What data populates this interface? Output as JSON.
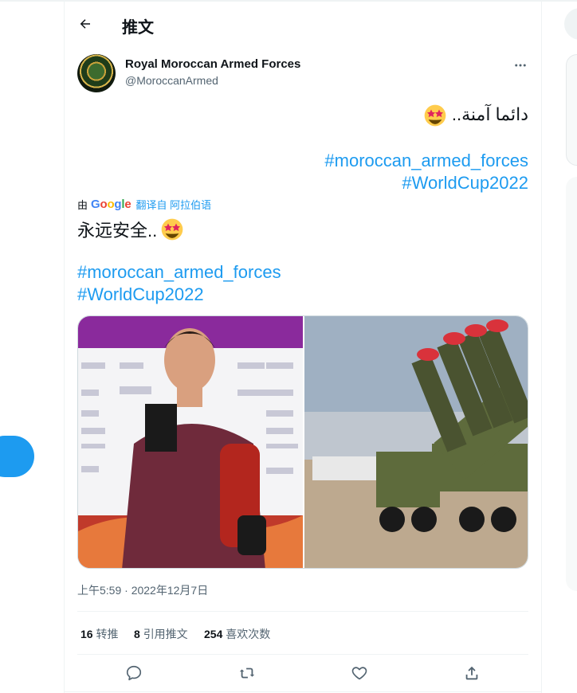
{
  "header": {
    "title": "推文"
  },
  "tweet": {
    "author": {
      "name": "Royal Moroccan Armed Forces",
      "handle": "@MoroccanArmed"
    },
    "text_ar": "دائما آمنة..",
    "hashtags_ar": [
      "#moroccan_armed_forces",
      "#WorldCup2022"
    ],
    "translation": {
      "by_label": "由",
      "google_label": "Google",
      "link_label": "翻译自 阿拉伯语",
      "text": "永远安全..",
      "hashtags": [
        "#moroccan_armed_forces",
        "#WorldCup2022"
      ]
    },
    "timestamp": "上午5:59 · 2022年12月7日",
    "stats": {
      "retweets_count": "16",
      "retweets_label": "转推",
      "quotes_count": "8",
      "quotes_label": "引用推文",
      "likes_count": "254",
      "likes_label": "喜欢次数"
    }
  },
  "icons": {
    "back": "arrow-left-icon",
    "more": "more-dots-icon",
    "reply": "reply-bubble-icon",
    "retweet": "retweet-icon",
    "like": "heart-icon",
    "share": "share-upload-icon",
    "emoji": "star-struck-emoji-icon"
  },
  "colors": {
    "accent": "#1d9bf0",
    "text_primary": "#0f1419",
    "text_secondary": "#536471",
    "border": "#eff3f4"
  }
}
